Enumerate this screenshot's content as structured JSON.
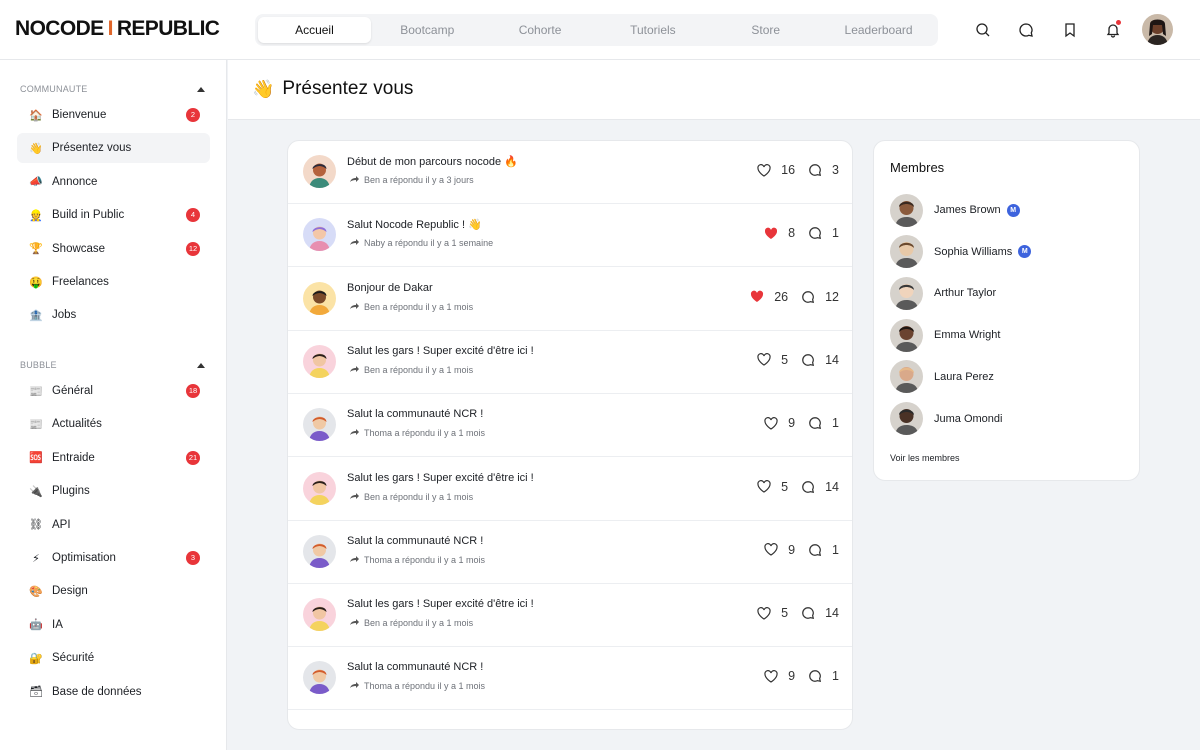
{
  "app": {
    "logo_left": "NOCODE",
    "logo_sep": "I",
    "logo_right": "REPUBLIC"
  },
  "nav": {
    "tabs": [
      {
        "label": "Accueil",
        "active": true
      },
      {
        "label": "Bootcamp",
        "active": false
      },
      {
        "label": "Cohorte",
        "active": false
      },
      {
        "label": "Tutoriels",
        "active": false
      },
      {
        "label": "Store",
        "active": false
      },
      {
        "label": "Leaderboard",
        "active": false
      }
    ],
    "icons": [
      "search-icon",
      "chat-icon",
      "bookmark-icon",
      "bell-icon"
    ]
  },
  "sidebar": {
    "sections": [
      {
        "title": "COMMUNAUTE",
        "items": [
          {
            "emoji": "🏠",
            "label": "Bienvenue",
            "badge": "2",
            "active": false
          },
          {
            "emoji": "👋",
            "label": "Présentez vous",
            "badge": "",
            "active": true
          },
          {
            "emoji": "📣",
            "label": "Annonce",
            "badge": "",
            "active": false
          },
          {
            "emoji": "👷",
            "label": "Build in Public",
            "badge": "4",
            "active": false
          },
          {
            "emoji": "🏆",
            "label": "Showcase",
            "badge": "12",
            "active": false
          },
          {
            "emoji": "🤑",
            "label": "Freelances",
            "badge": "",
            "active": false
          },
          {
            "emoji": "🏦",
            "label": "Jobs",
            "badge": "",
            "active": false
          }
        ]
      },
      {
        "title": "BUBBLE",
        "items": [
          {
            "emoji": "📰",
            "label": "Général",
            "badge": "18",
            "active": false
          },
          {
            "emoji": "📰",
            "label": "Actualités",
            "badge": "",
            "active": false
          },
          {
            "emoji": "🆘",
            "label": "Entraide",
            "badge": "21",
            "active": false
          },
          {
            "emoji": "🔌",
            "label": "Plugins",
            "badge": "",
            "active": false
          },
          {
            "emoji": "⛓",
            "label": "API",
            "badge": "",
            "active": false
          },
          {
            "emoji": "⚡",
            "label": "Optimisation",
            "badge": "3",
            "active": false
          },
          {
            "emoji": "🎨",
            "label": "Design",
            "badge": "",
            "active": false
          },
          {
            "emoji": "🤖",
            "label": "IA",
            "badge": "",
            "active": false
          },
          {
            "emoji": "🔐",
            "label": "Sécurité",
            "badge": "",
            "active": false
          },
          {
            "emoji": "🗃",
            "label": "Base de données",
            "badge": "",
            "active": false
          }
        ]
      }
    ]
  },
  "page": {
    "emoji": "👋",
    "title": "Présentez vous"
  },
  "posts": [
    {
      "title": "Début de mon parcours nocode 🔥",
      "meta": "Ben a répondu il y a 3 jours",
      "likes": "16",
      "liked": false,
      "comments": "3",
      "avatar": "orange"
    },
    {
      "title": "Salut Nocode Republic ! 👋",
      "meta": "Naby a répondu il y a 1 semaine",
      "likes": "8",
      "liked": true,
      "comments": "1",
      "avatar": "blue"
    },
    {
      "title": "Bonjour de Dakar",
      "meta": "Ben a répondu il y a 1 mois",
      "likes": "26",
      "liked": true,
      "comments": "12",
      "avatar": "yellow"
    },
    {
      "title": "Salut les gars ! Super excité d'être ici !",
      "meta": "Ben a répondu il y a 1 mois",
      "likes": "5",
      "liked": false,
      "comments": "14",
      "avatar": "pink"
    },
    {
      "title": "Salut la communauté NCR !",
      "meta": "Thoma a répondu il y a 1 mois",
      "likes": "9",
      "liked": false,
      "comments": "1",
      "avatar": "grey"
    },
    {
      "title": "Salut les gars ! Super excité d'être ici !",
      "meta": "Ben a répondu il y a 1 mois",
      "likes": "5",
      "liked": false,
      "comments": "14",
      "avatar": "pink"
    },
    {
      "title": "Salut la communauté NCR !",
      "meta": "Thoma a répondu il y a 1 mois",
      "likes": "9",
      "liked": false,
      "comments": "1",
      "avatar": "grey"
    },
    {
      "title": "Salut les gars ! Super excité d'être ici !",
      "meta": "Ben a répondu il y a 1 mois",
      "likes": "5",
      "liked": false,
      "comments": "14",
      "avatar": "pink"
    },
    {
      "title": "Salut la communauté NCR !",
      "meta": "Thoma a répondu il y a 1 mois",
      "likes": "9",
      "liked": false,
      "comments": "1",
      "avatar": "grey"
    }
  ],
  "members": {
    "title": "Membres",
    "list": [
      {
        "name": "James Brown",
        "badge": "M"
      },
      {
        "name": "Sophia Williams",
        "badge": "M"
      },
      {
        "name": "Arthur Taylor",
        "badge": ""
      },
      {
        "name": "Emma Wright",
        "badge": ""
      },
      {
        "name": "Laura Perez",
        "badge": ""
      },
      {
        "name": "Juma Omondi",
        "badge": ""
      }
    ],
    "see_all": "Voir les membres"
  },
  "colors": {
    "accent": "#e0662a",
    "badge": "#e8353a",
    "heart": "#e8353a",
    "mod_badge": "#3d63dd"
  }
}
